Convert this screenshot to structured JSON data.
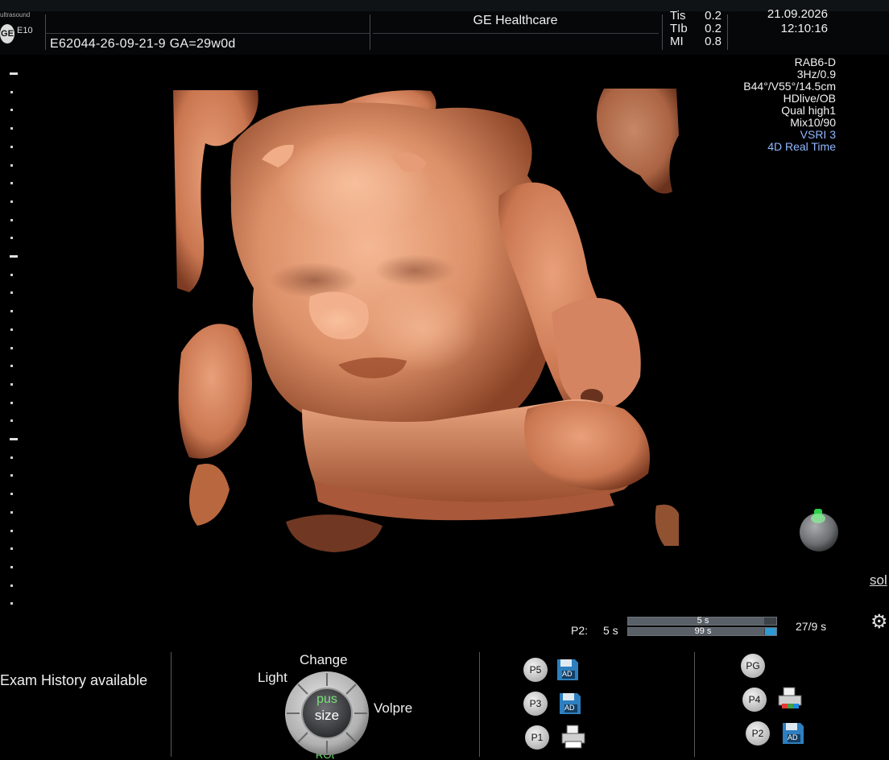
{
  "header": {
    "logo": "GE",
    "logo_sub": "ultrasound",
    "probe_model": "E10",
    "patient_id": "E62044-26-09-21-9  GA=29w0d",
    "institution": "GE Healthcare",
    "acoustic": [
      {
        "label": "Tis",
        "value": "0.2"
      },
      {
        "label": "TIb",
        "value": "0.2"
      },
      {
        "label": "MI",
        "value": "0.8"
      }
    ],
    "date": "21.09.2026",
    "time": "12:10:16"
  },
  "params": {
    "probe": "RAB6-D",
    "frequency": "3Hz/0.9",
    "angles": "B44°/V55°/14.5cm",
    "preset": "HDlive/OB",
    "quality": "Qual high1",
    "mix": "Mix10/90",
    "vsri": "VSRI 3",
    "mode": "4D Real Time"
  },
  "side": {
    "text": "sol",
    "settings_icon": "gear-icon",
    "orientation_icon": "orientation-ball-icon"
  },
  "cine": {
    "label": "P2:",
    "speed": "5 s",
    "bar_top_text": "5 s",
    "bar_bottom_text": "99 s",
    "progress": 0.92,
    "count": "27/9 s"
  },
  "bottom": {
    "exam_history": "Exam History available",
    "knob": {
      "top": "Change",
      "left": "Light",
      "right": "Volpre",
      "bottom": "ROt",
      "center_top": "pus",
      "center_bottom": "size"
    },
    "buttons_left": [
      {
        "label": "P5",
        "icon": "save-disk-icon",
        "icon_text": "AD"
      },
      {
        "label": "P3",
        "icon": "save-disk-icon",
        "icon_text": "AD"
      },
      {
        "label": "P1",
        "icon": "printer-icon",
        "icon_text": ""
      }
    ],
    "buttons_right": [
      {
        "label": "PG",
        "icon": "",
        "icon_text": ""
      },
      {
        "label": "P4",
        "icon": "color-printer-icon",
        "icon_text": ""
      },
      {
        "label": "P2",
        "icon": "save-disk-icon",
        "icon_text": "AD"
      }
    ]
  },
  "colors": {
    "skin_light": "#f2b08c",
    "skin_mid": "#d2855c",
    "skin_dark": "#8a4326",
    "blue_text": "#8fb8ff",
    "cine_blue": "#2d9ad3",
    "knob_center_text": "#79e07a"
  }
}
